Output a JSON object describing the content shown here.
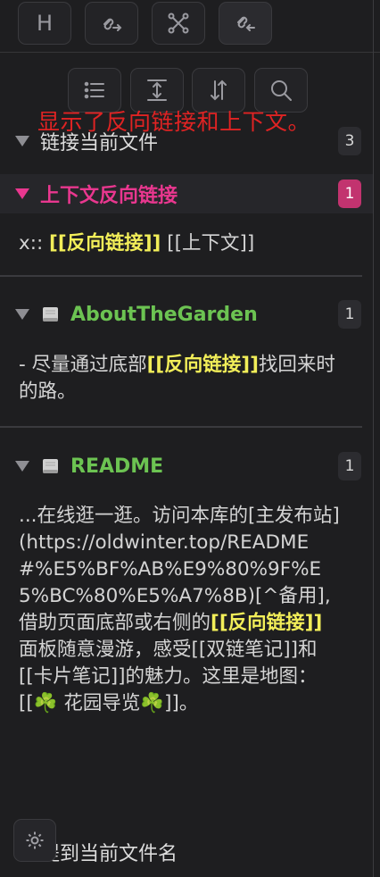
{
  "top_toolbar": {
    "buttons": [
      {
        "label": "H",
        "icon": "heading-icon"
      },
      {
        "icon": "link-forward-icon"
      },
      {
        "icon": "graph-icon"
      },
      {
        "icon": "link-back-icon"
      }
    ]
  },
  "tools": [
    {
      "icon": "list-icon"
    },
    {
      "icon": "expand-vertical-icon"
    },
    {
      "icon": "sort-icon"
    },
    {
      "icon": "search-icon"
    }
  ],
  "overlay_annotation": "显示了反向链接和上下文。",
  "sections": {
    "current_file": {
      "label": "链接当前文件",
      "count": "3"
    },
    "context_backlinks": {
      "label": "上下文反向链接",
      "count": "1",
      "line_prefix": "x:: ",
      "link1": "[[反向链接]]",
      "link2": " [[上下文]]"
    },
    "about": {
      "title": "AboutTheGarden",
      "count": "1",
      "t1": "- 尽量通过底部",
      "link": "[[反向链接]]",
      "t2": "找回来时的路。"
    },
    "readme": {
      "title": "README",
      "count": "1",
      "t1": "...在线逛一逛。访问本库的[主发布站](https://oldwinter.top/README#%E5%BF%AB%E9%80%9F%E5%BC%80%E5%A7%8B)[^备用],借助页面底部或右侧的",
      "link": "[[反向链接]]",
      "t2": "面板随意漫游，感受[[双链笔记]]和[[卡片笔记]]的魅力。这里是地图：[[☘️ 花园导览☘️]]。"
    },
    "unlinked": {
      "label": "提到当前文件名"
    }
  },
  "colors": {
    "accent_pink": "#e9378f",
    "highlight_yellow": "#f2ee59",
    "file_green": "#6cc352",
    "annotation_red": "#e02323"
  }
}
